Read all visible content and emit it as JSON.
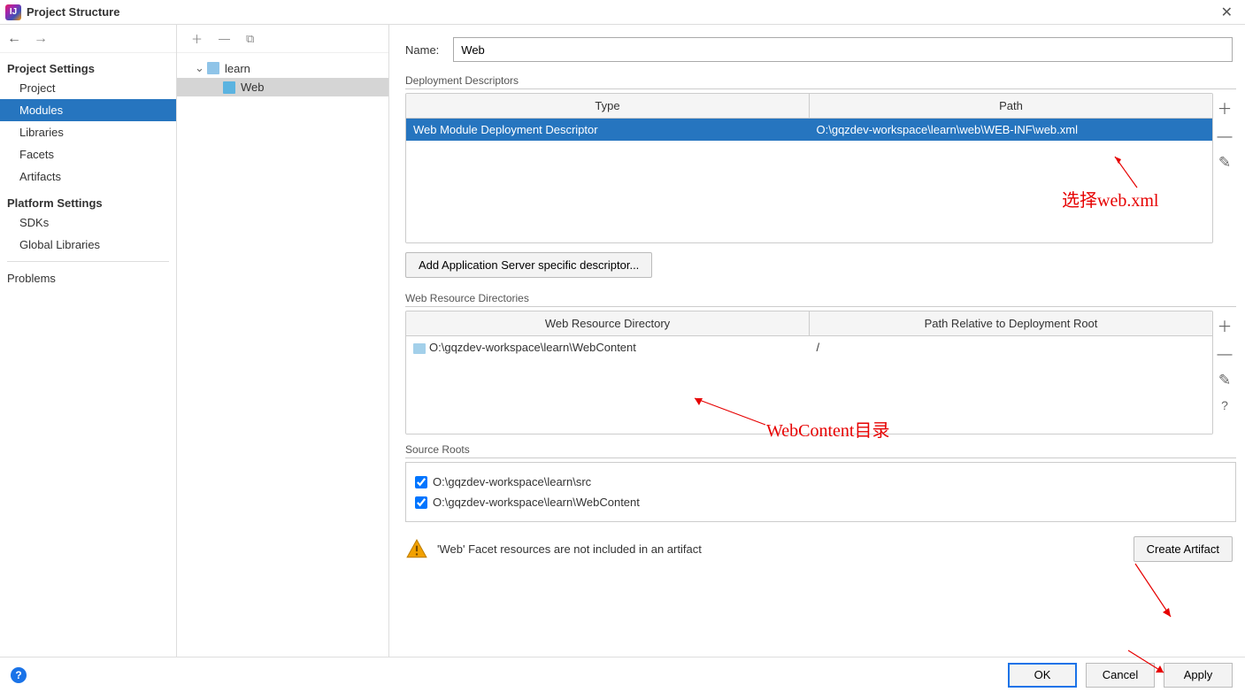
{
  "window": {
    "title": "Project Structure"
  },
  "nav": {
    "projectSettings": "Project Settings",
    "items1": [
      "Project",
      "Modules",
      "Libraries",
      "Facets",
      "Artifacts"
    ],
    "selected1": "Modules",
    "platformSettings": "Platform Settings",
    "items2": [
      "SDKs",
      "Global Libraries"
    ],
    "problems": "Problems"
  },
  "tree": {
    "root": "learn",
    "child": "Web"
  },
  "form": {
    "nameLabel": "Name:",
    "nameValue": "Web",
    "deployDescriptorsLabel": "Deployment Descriptors",
    "deployTable": {
      "headers": [
        "Type",
        "Path"
      ],
      "rows": [
        {
          "type": "Web Module Deployment Descriptor",
          "path": "O:\\gqzdev-workspace\\learn\\web\\WEB-INF\\web.xml"
        }
      ]
    },
    "addServerDescBtn": "Add Application Server specific descriptor...",
    "webResourceLabel": "Web Resource Directories",
    "webResourceTable": {
      "headers": [
        "Web Resource Directory",
        "Path Relative to Deployment Root"
      ],
      "rows": [
        {
          "dir": "O:\\gqzdev-workspace\\learn\\WebContent",
          "rel": "/"
        }
      ]
    },
    "sourceRootsLabel": "Source Roots",
    "sourceRoots": [
      "O:\\gqzdev-workspace\\learn\\src",
      "O:\\gqzdev-workspace\\learn\\WebContent"
    ],
    "warningText": "'Web' Facet resources are not included in an artifact",
    "createArtifactBtn": "Create Artifact"
  },
  "buttons": {
    "ok": "OK",
    "cancel": "Cancel",
    "apply": "Apply"
  },
  "annotations": {
    "webxml": "选择web.xml",
    "webcontent": "WebContent目录"
  }
}
